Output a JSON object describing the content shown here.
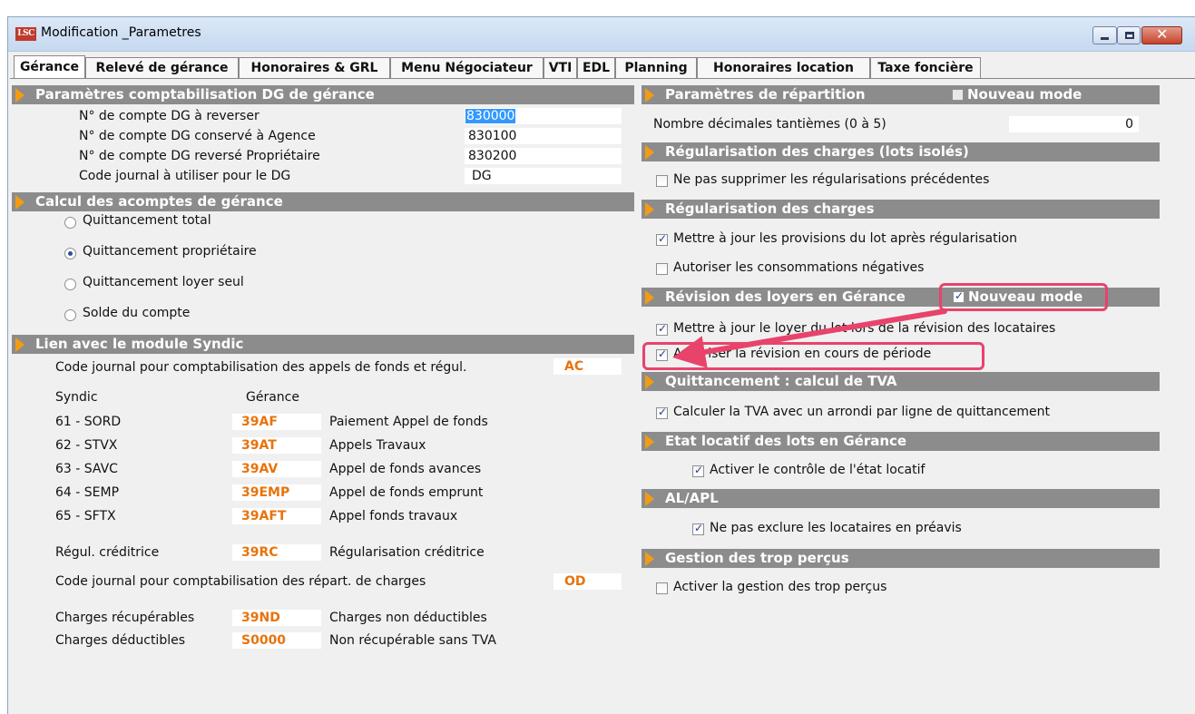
{
  "window": {
    "title": "Modification _Parametres",
    "icon": "LSC"
  },
  "tabs": [
    "Gérance",
    "Relevé de gérance",
    "Honoraires & GRL",
    "Menu Négociateur",
    "VTI",
    "EDL",
    "Planning",
    "Honoraires location",
    "Taxe foncière"
  ],
  "left": {
    "dg": {
      "header": "Paramètres comptabilisation DG de gérance",
      "rows": [
        {
          "label": "N° de compte DG à reverser",
          "value": "830000"
        },
        {
          "label": "N° de compte DG conservé à Agence",
          "value": "830100"
        },
        {
          "label": "N° de compte DG reversé Propriétaire",
          "value": "830200"
        },
        {
          "label": "Code journal à utiliser pour le DG",
          "value": "DG"
        }
      ]
    },
    "acomptes": {
      "header": "Calcul des acomptes de gérance",
      "options": [
        "Quittancement total",
        "Quittancement propriétaire",
        "Quittancement loyer seul",
        "Solde du compte"
      ],
      "selected": 1
    },
    "syndic": {
      "header": "Lien avec le module Syndic",
      "journal_label": "Code journal pour comptabilisation des appels de fonds et régul.",
      "journal_value": "AC",
      "col_syndic": "Syndic",
      "col_gerance": "Gérance",
      "rows": [
        {
          "syndic": "61 - SORD",
          "code": "39AF",
          "desc": "Paiement Appel de fonds"
        },
        {
          "syndic": "62 - STVX",
          "code": "39AT",
          "desc": "Appels Travaux"
        },
        {
          "syndic": "63 - SAVC",
          "code": "39AV",
          "desc": "Appel de fonds avances"
        },
        {
          "syndic": "64 - SEMP",
          "code": "39EMP",
          "desc": "Appel de fonds emprunt"
        },
        {
          "syndic": "65 - SFTX",
          "code": "39AFT",
          "desc": "Appel fonds travaux"
        }
      ],
      "regul": {
        "label": "Régul. créditrice",
        "code": "39RC",
        "desc": "Régularisation créditrice"
      },
      "repart_label": "Code journal pour comptabilisation des répart. de charges",
      "repart_value": "OD",
      "charges": [
        {
          "label": "Charges récupérables",
          "code": "39ND",
          "desc": "Charges non déductibles"
        },
        {
          "label": "Charges déductibles",
          "code": "S0000",
          "desc": "Non récupérable sans TVA"
        }
      ]
    }
  },
  "right": {
    "repartition": {
      "header": "Paramètres de répartition",
      "mode_label": "Nouveau mode",
      "mode_checked": false,
      "decimals_label": "Nombre décimales tantièmes (0 à 5)",
      "decimals_value": "0"
    },
    "regul_isoles": {
      "header": "Régularisation des charges (lots isolés)",
      "items": [
        {
          "label": "Ne pas supprimer les régularisations précédentes",
          "checked": false
        }
      ]
    },
    "regul": {
      "header": "Régularisation des charges",
      "items": [
        {
          "label": "Mettre à jour les provisions du lot après régularisation",
          "checked": true
        },
        {
          "label": "Autoriser les consommations négatives",
          "checked": false
        }
      ]
    },
    "revision": {
      "header": "Révision des loyers en Gérance",
      "mode_label": "Nouveau mode",
      "mode_checked": true,
      "items": [
        {
          "label": "Mettre à jour le loyer du lot lors de la révision des locataires",
          "checked": true
        },
        {
          "label": "Autoriser la révision en cours de période",
          "checked": true
        }
      ]
    },
    "tva": {
      "header": "Quittancement : calcul de TVA",
      "items": [
        {
          "label": "Calculer la TVA avec un arrondi par ligne de quittancement",
          "checked": true
        }
      ]
    },
    "etat": {
      "header": "Etat locatif des lots en Gérance",
      "items": [
        {
          "label": "Activer le contrôle de l'état locatif",
          "checked": true
        }
      ]
    },
    "alapl": {
      "header": "AL/APL",
      "items": [
        {
          "label": "Ne pas exclure les locataires en préavis",
          "checked": true
        }
      ]
    },
    "trop": {
      "header": "Gestion des trop perçus",
      "items": [
        {
          "label": "Activer la gestion des trop perçus",
          "checked": false
        }
      ]
    }
  },
  "colors": {
    "accent_orange": "#e8730c",
    "header_gray": "#8c8c8c",
    "highlight": "#e8436b"
  }
}
